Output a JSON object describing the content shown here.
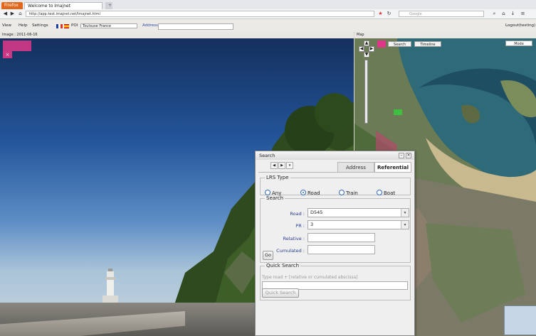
{
  "browser": {
    "tabs": [
      {
        "label": "Firefox"
      },
      {
        "label": "Welcome to Imajnet"
      }
    ],
    "url": "http://app.test.imajnet.net/Imajnet.html",
    "search_placeholder": "Google"
  },
  "app": {
    "menu": [
      "View",
      "Help",
      "Settings"
    ],
    "place_label": "POI",
    "place_value": "Toulouse France",
    "address_label": "Address",
    "login_label": "Logout(testing)"
  },
  "image_panel": {
    "title": "Image : 2011-06-16"
  },
  "map_panel": {
    "title": "Map",
    "buttons": [
      "Search",
      "Timeline"
    ],
    "mode": "Mode"
  },
  "dialog": {
    "title": "Search",
    "tabs": {
      "address": "Address",
      "referential": "Referential"
    },
    "lrs_type": {
      "legend": "LRS Type",
      "options": [
        {
          "label": "Any",
          "selected": false
        },
        {
          "label": "Road",
          "selected": true
        },
        {
          "label": "Train",
          "selected": false
        },
        {
          "label": "Boat",
          "selected": false
        }
      ]
    },
    "search": {
      "legend": "Search",
      "road_label": "Road :",
      "road_value": "D545",
      "pr_label": "PR :",
      "pr_value": "3",
      "relative_label": "Relative :",
      "cumulated_label": "Cumulated :",
      "go_label": "Go"
    },
    "quick_search": {
      "legend": "Quick Search",
      "hint": "Type road + [relative or cumulated abscissa]",
      "button_label": "Quick Search"
    }
  }
}
